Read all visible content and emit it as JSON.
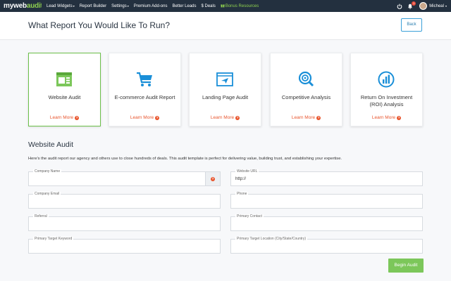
{
  "nav": {
    "logo_text_main": "myweb",
    "logo_text_accent": "audit",
    "items": [
      {
        "label": "Lead Widgets",
        "caret": "▾"
      },
      {
        "label": "Report Builder",
        "caret": ""
      },
      {
        "label": "Settings",
        "caret": "▾"
      },
      {
        "label": "Premium Add-ons",
        "caret": ""
      },
      {
        "label": "Better Leads",
        "caret": ""
      },
      {
        "label": "$ Deals",
        "caret": ""
      },
      {
        "label": "Bonus Resources",
        "caret": ""
      }
    ],
    "notification_count": "1",
    "user_name": "Micheal",
    "user_caret": "▾",
    "icons": [
      "power-icon",
      "bell-icon",
      "avatar"
    ]
  },
  "header": {
    "title": "What Report You Would Like To Run?",
    "back_label": "Back"
  },
  "cards": [
    {
      "title": "Website Audit",
      "learn": "Learn More",
      "icon": "browser-window-icon",
      "selected": true
    },
    {
      "title": "E-commerce Audit Report",
      "learn": "Learn More",
      "icon": "shopping-cart-icon",
      "selected": false
    },
    {
      "title": "Landing Page Audit",
      "learn": "Learn More",
      "icon": "paper-plane-icon",
      "selected": false
    },
    {
      "title": "Competitive Analysis",
      "learn": "Learn More",
      "icon": "target-search-icon",
      "selected": false
    },
    {
      "title": "Return On Investment (ROI) Analysis",
      "learn": "Learn More",
      "icon": "bar-chart-icon",
      "selected": false
    }
  ],
  "audit": {
    "title": "Website Audit",
    "description": "Here's the audit report our agency and others use to close hundreds of deals. This audit template is perfect for delivering value, building trust, and establishing your expertise.",
    "fields": [
      {
        "label": "Company Name",
        "value": ""
      },
      {
        "label": "Website URL",
        "value": "http://"
      },
      {
        "label": "Company Email",
        "value": ""
      },
      {
        "label": "Phone",
        "value": ""
      },
      {
        "label": "Referral",
        "value": ""
      },
      {
        "label": "Primary Contact",
        "value": ""
      },
      {
        "label": "Primary Target Keyword",
        "value": ""
      },
      {
        "label": "Primary Target Location (City/State/Country)",
        "value": ""
      }
    ],
    "begin_label": "Begin Audit"
  },
  "help_glyph": "?",
  "colors": {
    "nav_bg": "#23303f",
    "accent_green": "#7cc75a",
    "accent_blue": "#1a8fd8",
    "learn_orange": "#e8542c"
  }
}
